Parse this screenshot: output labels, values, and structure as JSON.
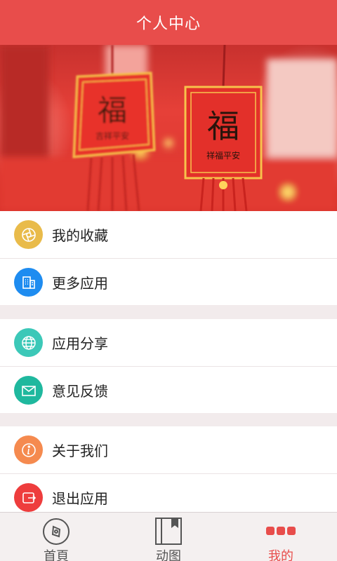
{
  "header": {
    "title": "个人中心"
  },
  "banner": {
    "left_char": "福",
    "right_char": "福",
    "left_sub": "吉祥平安",
    "right_sub": "祥福平安"
  },
  "menu_groups": [
    {
      "items": [
        {
          "label": "我的收藏",
          "icon": "aperture-icon",
          "color": "#e9bb4a"
        },
        {
          "label": "更多应用",
          "icon": "building-icon",
          "color": "#1e8cf0"
        }
      ]
    },
    {
      "items": [
        {
          "label": "应用分享",
          "icon": "globe-icon",
          "color": "#3cc8b8"
        },
        {
          "label": "意见反馈",
          "icon": "mail-icon",
          "color": "#1fb89e"
        }
      ]
    },
    {
      "items": [
        {
          "label": "关于我们",
          "icon": "info-icon",
          "color": "#f58a4f"
        },
        {
          "label": "退出应用",
          "icon": "exit-icon",
          "color": "#ee3d3d"
        }
      ]
    }
  ],
  "tabbar": {
    "tabs": [
      {
        "label": "首頁",
        "icon": "disc-icon",
        "active": false
      },
      {
        "label": "动图",
        "icon": "book-icon",
        "active": false
      },
      {
        "label": "我的",
        "icon": "dots-icon",
        "active": true
      }
    ],
    "active_color": "#e84d4b"
  }
}
